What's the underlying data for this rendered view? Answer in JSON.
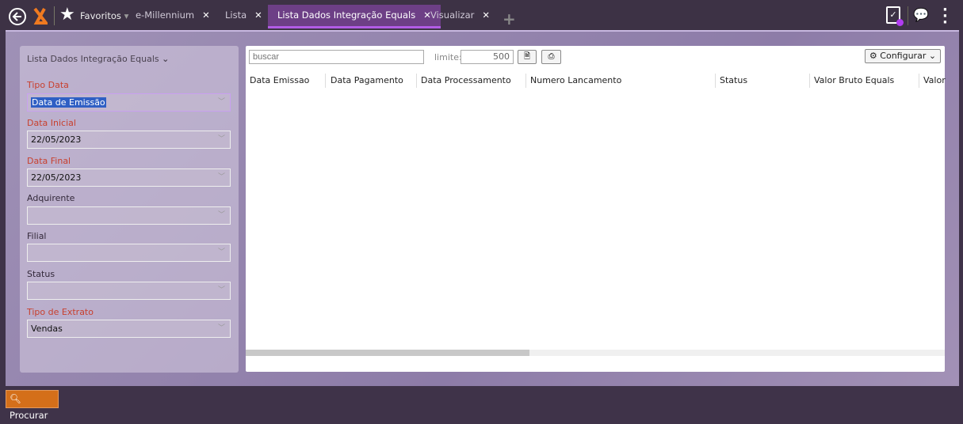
{
  "topbar": {
    "favorites": "Favoritos",
    "tabs": [
      {
        "label": "e-Millennium"
      },
      {
        "label": "Lista"
      },
      {
        "label": "Lista Dados Integração Equals",
        "active": true
      },
      {
        "label": "Visualizar"
      }
    ],
    "accent": "#b25ce6"
  },
  "filters": {
    "title": "Lista Dados Integração Equals",
    "fields": [
      {
        "label": "Tipo Data",
        "value": "Data de Emissão",
        "required": true
      },
      {
        "label": "Data Inicial",
        "value": "22/05/2023",
        "required": true
      },
      {
        "label": "Data Final",
        "value": "22/05/2023",
        "required": true
      },
      {
        "label": "Adquirente",
        "value": "",
        "required": false
      },
      {
        "label": "Filial",
        "value": "",
        "required": false
      },
      {
        "label": "Status",
        "value": "",
        "required": false
      },
      {
        "label": "Tipo de Extrato",
        "value": "Vendas",
        "required": true
      }
    ]
  },
  "grid": {
    "search_placeholder": "buscar",
    "limit_label": "limite:",
    "limit_value": "500",
    "configure_label": "Configurar",
    "columns": [
      "Data Emissao",
      "Data Pagamento",
      "Data Processamento",
      "Numero Lancamento",
      "Status",
      "Valor Bruto Equals",
      "Valor"
    ]
  },
  "footer": {
    "search_button": "Procurar"
  }
}
